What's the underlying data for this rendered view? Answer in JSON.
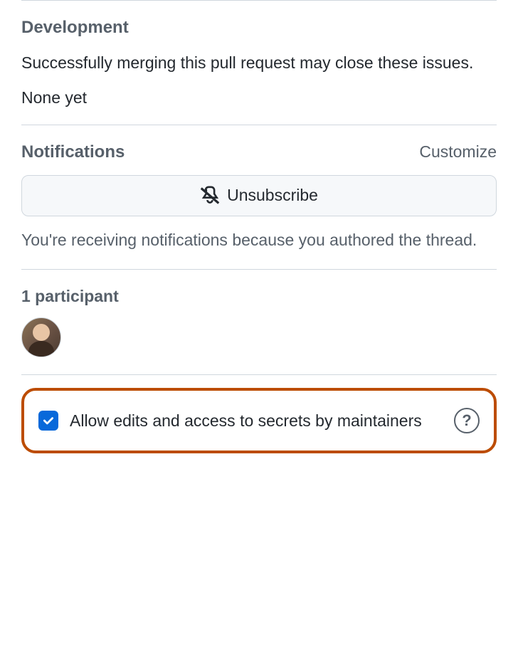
{
  "development": {
    "title": "Development",
    "description": "Successfully merging this pull request may close these issues.",
    "empty_state": "None yet"
  },
  "notifications": {
    "title": "Notifications",
    "customize_label": "Customize",
    "unsubscribe_label": "Unsubscribe",
    "reason": "You're receiving notifications because you authored the thread."
  },
  "participants": {
    "count_label": "1 participant"
  },
  "maintainer_edits": {
    "label": "Allow edits and access to secrets by maintainers",
    "checked": true,
    "help_glyph": "?"
  }
}
